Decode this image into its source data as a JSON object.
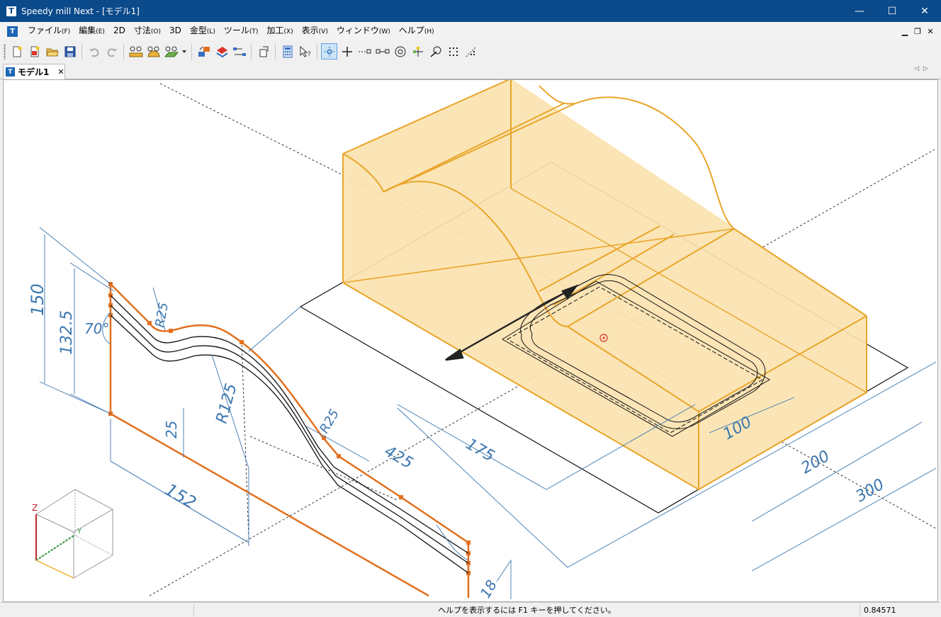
{
  "window": {
    "title": "Speedy mill Next - [モデル1]",
    "app_icon_glyph": "T",
    "minimize_glyph": "—",
    "maximize_glyph": "☐",
    "close_glyph": "✕"
  },
  "menubar": {
    "logo_glyph": "T",
    "items": [
      {
        "label": "ファイル",
        "accel": "(F)"
      },
      {
        "label": "編集",
        "accel": "(E)"
      },
      {
        "label": "2D",
        "accel": ""
      },
      {
        "label": "寸法",
        "accel": "(O)"
      },
      {
        "label": "3D",
        "accel": ""
      },
      {
        "label": "金型",
        "accel": "(L)"
      },
      {
        "label": "ツール",
        "accel": "(T)"
      },
      {
        "label": "加工",
        "accel": "(X)"
      },
      {
        "label": "表示",
        "accel": "(V)"
      },
      {
        "label": "ウィンドウ",
        "accel": "(W)"
      },
      {
        "label": "ヘルプ",
        "accel": "(H)"
      }
    ],
    "mdi_minimize": "▁",
    "mdi_restore": "❐",
    "mdi_close": "✕"
  },
  "toolbar": {
    "icons": [
      "new-file-icon",
      "new-model-icon",
      "open-folder-icon",
      "save-icon",
      "undo-icon",
      "redo-icon",
      "measure-ruler-icon",
      "measure-angle-icon",
      "measure-plane-icon",
      "layer-swap-icon",
      "layer-color-icon",
      "layer-link-icon",
      "export-icon",
      "calculator-icon",
      "select-cursor-icon",
      "snap-center-icon",
      "snap-cross-icon",
      "snap-endpoint-icon",
      "snap-midpoint-icon",
      "snap-circle-icon",
      "snap-node-icon",
      "snap-tangent-icon",
      "snap-grid-icon",
      "snap-path-icon"
    ],
    "accent": "#62a2e4"
  },
  "tabs": {
    "doc_tab_label": "モデル1",
    "doc_tab_icon_glyph": "T",
    "close_glyph": "✕",
    "nav_glyphs": "◁▷"
  },
  "viewport": {
    "dimensions": [
      "150",
      "132.5",
      "70°",
      "R25",
      "R125",
      "25",
      "152",
      "R25",
      "425",
      "175",
      "100",
      "200",
      "300",
      "18"
    ],
    "axes": {
      "z": "Z",
      "y": "Y"
    },
    "colors": {
      "solid_fill": "#fbe3b0",
      "solid_edge": "#e9a52a",
      "profile": "#e2701f",
      "dimension": "#3d78b0"
    }
  },
  "statusbar": {
    "help_text": "ヘルプを表示するには F1 キーを押してください。",
    "value": "0.84571"
  }
}
